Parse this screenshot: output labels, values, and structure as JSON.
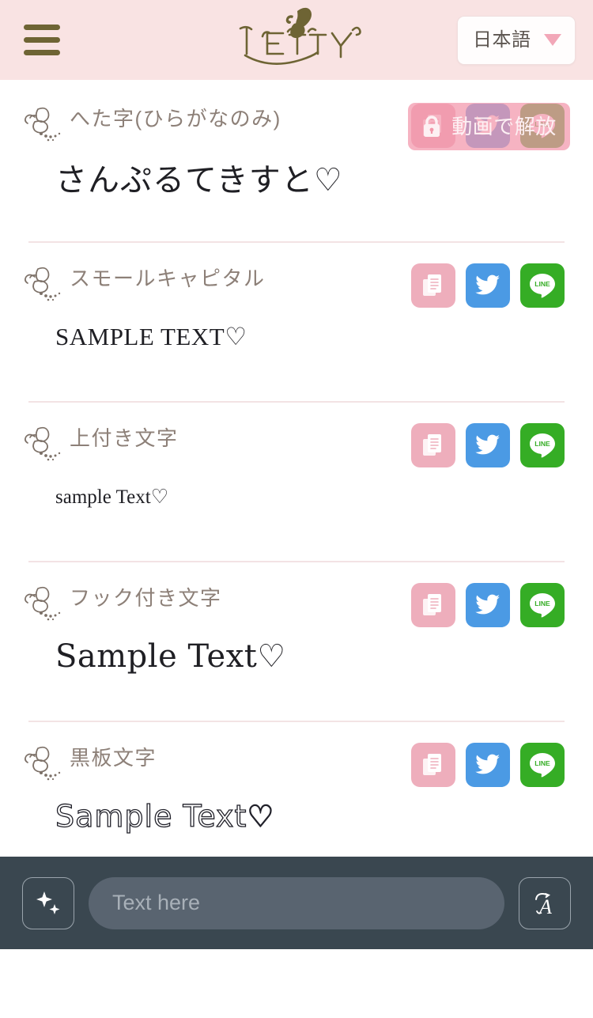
{
  "header": {
    "menu_label": "menu",
    "logo_text": "LETTY",
    "language": {
      "selected": "日本語",
      "caret": "chevron-down-icon"
    }
  },
  "rows": [
    {
      "label": "へた字(ひらがなのみ)",
      "sample": "さんぷるてきすと",
      "heart": "♡",
      "style": "heta",
      "locked": true,
      "lock_label": "動画で解放",
      "lock_icon": "lock-icon",
      "actions": [
        {
          "name": "copy",
          "label": "copy-icon",
          "color": "#eeaebc"
        },
        {
          "name": "twitter",
          "label": "twitter-icon",
          "color": "#4b9ae4"
        },
        {
          "name": "line",
          "label": "line-icon",
          "color": "#35ad25"
        }
      ]
    },
    {
      "label": "スモールキャピタル",
      "sample": "SAMPLE TEXT",
      "heart": "♡",
      "style": "smallcap",
      "locked": false,
      "actions": [
        {
          "name": "copy",
          "label": "copy-icon",
          "color": "#eeaebc"
        },
        {
          "name": "twitter",
          "label": "twitter-icon",
          "color": "#4b9ae4"
        },
        {
          "name": "line",
          "label": "line-icon",
          "color": "#35ad25"
        }
      ]
    },
    {
      "label": "上付き文字",
      "sample": "sample Text",
      "heart": "♡",
      "style": "sup",
      "locked": false,
      "actions": [
        {
          "name": "copy",
          "label": "copy-icon",
          "color": "#eeaebc"
        },
        {
          "name": "twitter",
          "label": "twitter-icon",
          "color": "#4b9ae4"
        },
        {
          "name": "line",
          "label": "line-icon",
          "color": "#35ad25"
        }
      ]
    },
    {
      "label": "フック付き文字",
      "sample": "Sample Text",
      "heart": "♡",
      "style": "hook",
      "locked": false,
      "actions": [
        {
          "name": "copy",
          "label": "copy-icon",
          "color": "#eeaebc"
        },
        {
          "name": "twitter",
          "label": "twitter-icon",
          "color": "#4b9ae4"
        },
        {
          "name": "line",
          "label": "line-icon",
          "color": "#35ad25"
        }
      ]
    },
    {
      "label": "黒板文字",
      "sample": "Sample Text",
      "heart": "♡",
      "style": "board",
      "locked": false,
      "actions": [
        {
          "name": "copy",
          "label": "copy-icon",
          "color": "#eeaebc"
        },
        {
          "name": "twitter",
          "label": "twitter-icon",
          "color": "#4b9ae4"
        },
        {
          "name": "line",
          "label": "line-icon",
          "color": "#35ad25"
        }
      ]
    }
  ],
  "bottom_bar": {
    "decorate_button": "sparkles-icon",
    "input": {
      "value": "",
      "placeholder": "Text here"
    },
    "font_button": "script-a-icon"
  },
  "colors": {
    "header_bg": "#f9e3e3",
    "logo": "#6e6434",
    "label_text": "#8d8078",
    "divider": "#f3e3e4",
    "lock_overlay": "#f396aa",
    "bottom_bar_bg": "#3a4750",
    "input_bg": "#596470",
    "accent_pink": "#f2a7b8"
  }
}
